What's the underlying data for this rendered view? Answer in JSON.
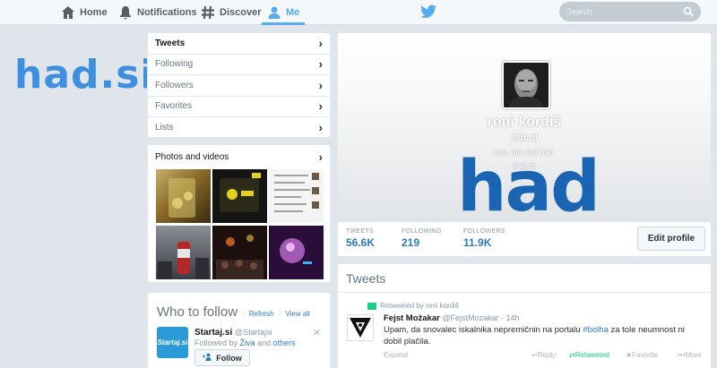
{
  "nav": {
    "home": "Home",
    "notifications": "Notifications",
    "discover": "Discover",
    "me": "Me",
    "search_placeholder": "Search"
  },
  "logo": {
    "text": "had.si"
  },
  "menu": {
    "items": [
      {
        "label": "Tweets"
      },
      {
        "label": "Following"
      },
      {
        "label": "Followers"
      },
      {
        "label": "Favorites"
      },
      {
        "label": "Lists"
      }
    ]
  },
  "photos": {
    "title": "Photos and videos"
  },
  "who_to_follow": {
    "title": "Who to follow",
    "refresh": "Refresh",
    "view_all": "View all",
    "separator": "·",
    "suggestion": {
      "avatar_text": "Startaj.si",
      "name": "Startaj.si",
      "handle": "@Startajsi",
      "followed_by_prefix": "Followed by",
      "followed_by_name": "Živa",
      "followed_by_and": "and",
      "followed_by_others": "others",
      "follow_label": "Follow"
    }
  },
  "profile": {
    "name": "roni kordiš",
    "handle": "@had",
    "bio": "me, me and me!",
    "url": "had.si",
    "banner_text": "had",
    "stats": [
      {
        "label": "TWEETS",
        "value": "56.6K"
      },
      {
        "label": "FOLLOWING",
        "value": "219"
      },
      {
        "label": "FOLLOWERS",
        "value": "11.9K"
      }
    ],
    "edit_label": "Edit profile"
  },
  "tweets": {
    "title": "Tweets",
    "item": {
      "retweeted_by": "Retweeted by roni kordiš",
      "name": "Fejst Možakar",
      "handle": "@FejstMozakar",
      "time": "· 14h",
      "text_before": "Upam, da snovalec iskalnika nepremičnin na portalu ",
      "hashtag": "#bolha",
      "text_after": " za tole neumnost ni dobil plačila.",
      "expand": "Expand",
      "reply": "Reply",
      "retweeted": "Retweeted",
      "favorite": "Favorite",
      "more": "More"
    }
  },
  "colors": {
    "accent": "#55acee",
    "link": "#2b7bb9",
    "logo": "#3e8fe0",
    "retweet": "#19cf86"
  }
}
